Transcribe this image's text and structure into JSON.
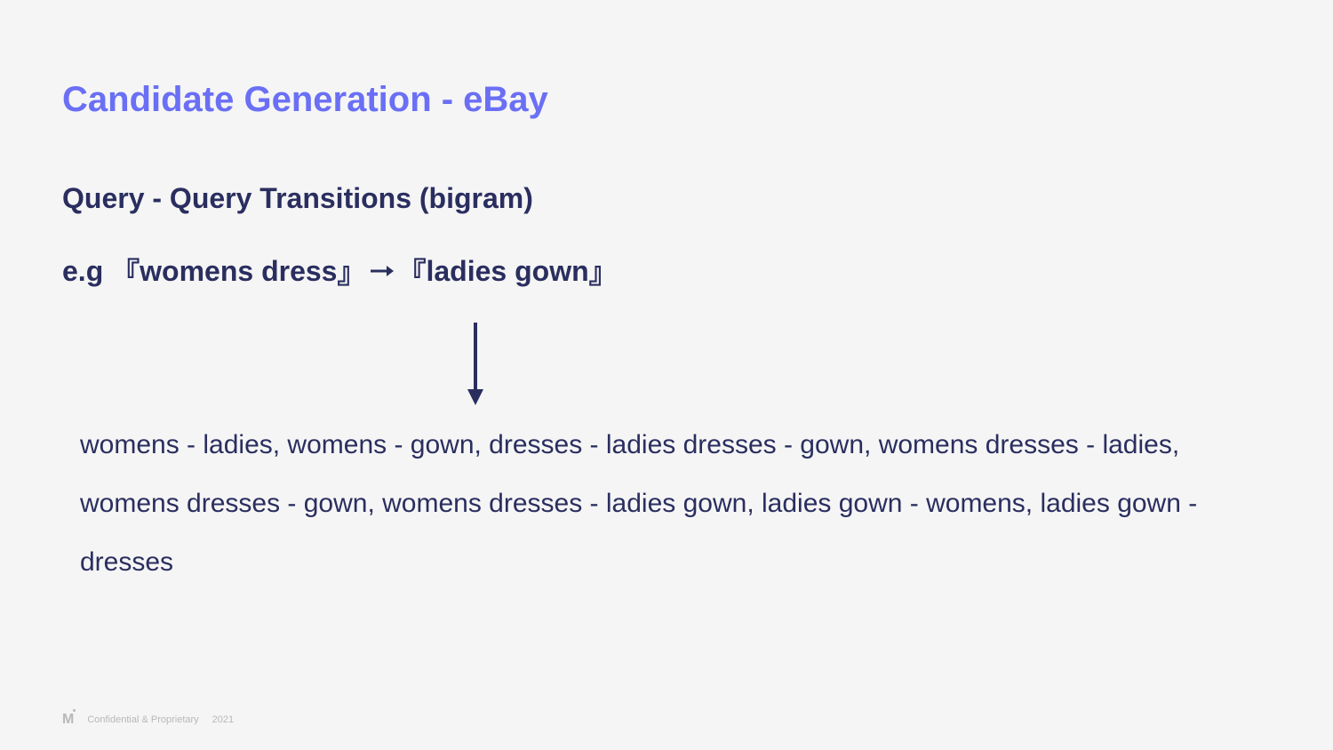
{
  "slide": {
    "title": "Candidate Generation - eBay",
    "subtitle": "Query - Query Transitions (bigram)",
    "example": {
      "prefix": "e.g ",
      "query1_open": "『",
      "query1_text": "womens dress",
      "query1_close": "』",
      "query2_open": "『",
      "query2_text": "ladies gown",
      "query2_close": "』"
    },
    "body": "womens - ladies, womens - gown, dresses - ladies dresses - gown, womens dresses - ladies, womens dresses - gown, womens dresses - ladies gown, ladies gown - womens, ladies gown - dresses"
  },
  "footer": {
    "logo": "M",
    "confidential": "Confidential & Proprietary",
    "year": "2021"
  },
  "colors": {
    "accent": "#6a6ff5",
    "text_dark": "#2a2e5f",
    "bg": "#f5f5f5",
    "footer_muted": "#b8b8b8"
  }
}
